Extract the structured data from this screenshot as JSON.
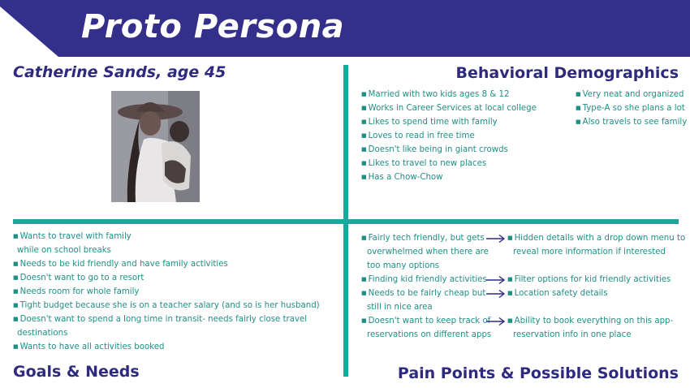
{
  "header": {
    "title": "Proto Persona"
  },
  "persona": {
    "name_age": "Catherine Sands, age 45",
    "photo_alt": "Woman in a wide-brimmed hat holding a child"
  },
  "behavioral": {
    "title": "Behavioral Demographics",
    "left_items": [
      "Married with two kids ages 8 & 12",
      "Works in Career Services at local college",
      "Likes to spend time with family",
      "Loves to read in free time",
      "Doesn't like being in giant crowds",
      "Likes to travel to new places",
      "Has a Chow-Chow"
    ],
    "right_items": [
      "Very neat and organized",
      "Type-A so she plans a lot",
      "Also travels to see family"
    ]
  },
  "goals": {
    "title": "Goals & Needs",
    "lines": [
      "Wants to travel with family",
      "while on school breaks",
      "Needs to be kid friendly and have family activities",
      "Doesn't want to go to a resort",
      "Needs room for whole family",
      "Tight budget because she is on a teacher salary (and so is her husband)",
      "Doesn't want to spend a long time in transit- needs fairly close travel",
      "destinations",
      "Wants to have all activities booked"
    ]
  },
  "pain": {
    "title": "Pain Points & Possible Solutions",
    "p1": [
      "Fairly tech friendly, but gets",
      "overwhelmed when there are",
      "too many options"
    ],
    "s1": [
      "Hidden details with a drop down menu to",
      "reveal more information if interested"
    ],
    "p2": [
      "Finding kid friendly activities"
    ],
    "s2": [
      "Filter options for kid friendly activities"
    ],
    "p3": [
      "Needs to be fairly cheap but",
      "still in nice area"
    ],
    "s3": [
      "Location safety details"
    ],
    "p4": [
      "Doesn't want to keep track of",
      "reservations on different apps"
    ],
    "s4": [
      "Ability to book everything on this app-",
      "reservation info in one place"
    ]
  },
  "colors": {
    "banner": "#352f8c",
    "heading": "#2e2a7e",
    "teal_text": "#1f8f85",
    "divider": "#1aa79e"
  }
}
